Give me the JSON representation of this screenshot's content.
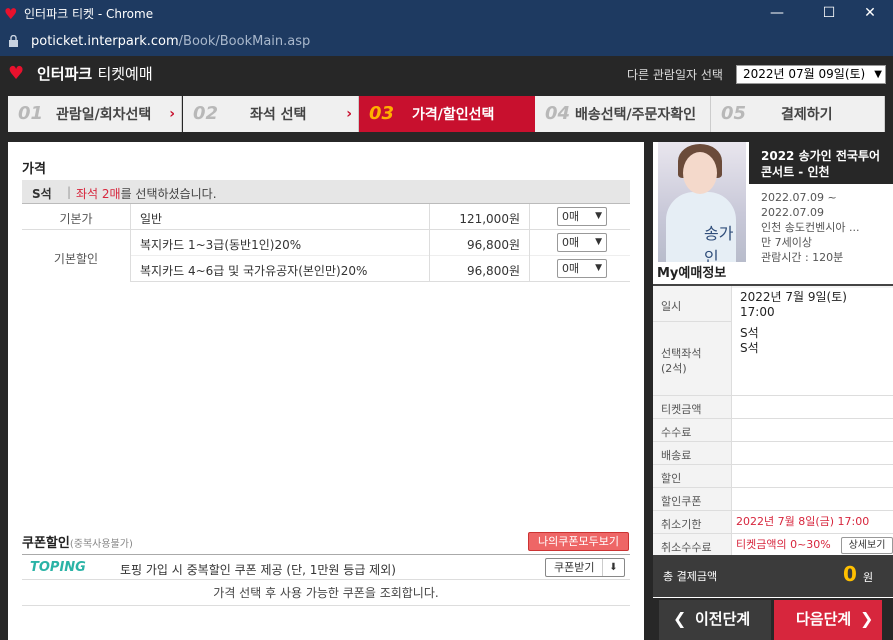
{
  "window": {
    "title": "인터파크 티켓 - Chrome",
    "url_host": "poticket.interpark.com",
    "url_path": "/Book/BookMain.asp"
  },
  "header": {
    "logo": "인터파크",
    "logo_sub": "티켓예매",
    "other_date_label": "다른 관람일자 선택",
    "selected_date": "2022년 07월 09일(토)"
  },
  "steps": [
    {
      "num": "01",
      "label": "관람일/회차선택"
    },
    {
      "num": "02",
      "label": "좌석 선택"
    },
    {
      "num": "03",
      "label": "가격/할인선택"
    },
    {
      "num": "04",
      "label": "배송선택/주문자확인"
    },
    {
      "num": "05",
      "label": "결제하기"
    }
  ],
  "price": {
    "title": "가격",
    "grade": "S석",
    "selected_prefix": "좌석 2매",
    "selected_suffix": "를 선택하셨습니다.",
    "rows": [
      {
        "category": "기본가",
        "name": "일반",
        "price": "121,000원",
        "qty": "0매"
      },
      {
        "category": "기본할인",
        "name": "복지카드 1~3급(동반1인)20%",
        "price": "96,800원",
        "qty": "0매"
      },
      {
        "category": "",
        "name": "복지카드 4~6급 및 국가유공자(본인만)20%",
        "price": "96,800원",
        "qty": "0매"
      }
    ]
  },
  "coupon": {
    "title": "쿠폰할인",
    "note": "(중복사용불가)",
    "view_all": "나의쿠폰모두보기",
    "logo": "TOPING",
    "desc": "토핑 가입 시 중복할인 쿠폰 제공 (단, 1만원 등급 제외)",
    "get_button": "쿠폰받기",
    "empty_msg": "가격 선택 후 사용 가능한 쿠폰을 조회합니다."
  },
  "show": {
    "title": "2022 송가인 전국투어 콘서트 - 인천",
    "period": "2022.07.09 ~ 2022.07.09",
    "venue": "인천 송도컨벤시아 ...",
    "age": "만 7세이상",
    "runtime": "관람시간 : 120분",
    "poster_text": "송가인"
  },
  "myinfo": {
    "title": "My예매정보",
    "date_label": "일시",
    "date_value": "2022년 7월 9일(토)",
    "time_value": "17:00",
    "seat_label": "선택좌석",
    "seat_count": "(2석)",
    "seat_1": "S석",
    "seat_2": "S석",
    "ticket_amount_label": "티켓금액",
    "fee_label": "수수료",
    "delivery_label": "배송료",
    "discount_label": "할인",
    "coupon_label": "할인쿠폰",
    "cancel_deadline_label": "취소기한",
    "cancel_deadline_value": "2022년 7월 8일(금) 17:00",
    "cancel_fee_label": "취소수수료",
    "cancel_fee_value": "티켓금액의 0~30%",
    "detail_button": "상세보기",
    "total_label": "총 결제금액",
    "total_value": "0",
    "total_unit": "원"
  },
  "nav": {
    "prev": "이전단계",
    "next": "다음단계"
  }
}
